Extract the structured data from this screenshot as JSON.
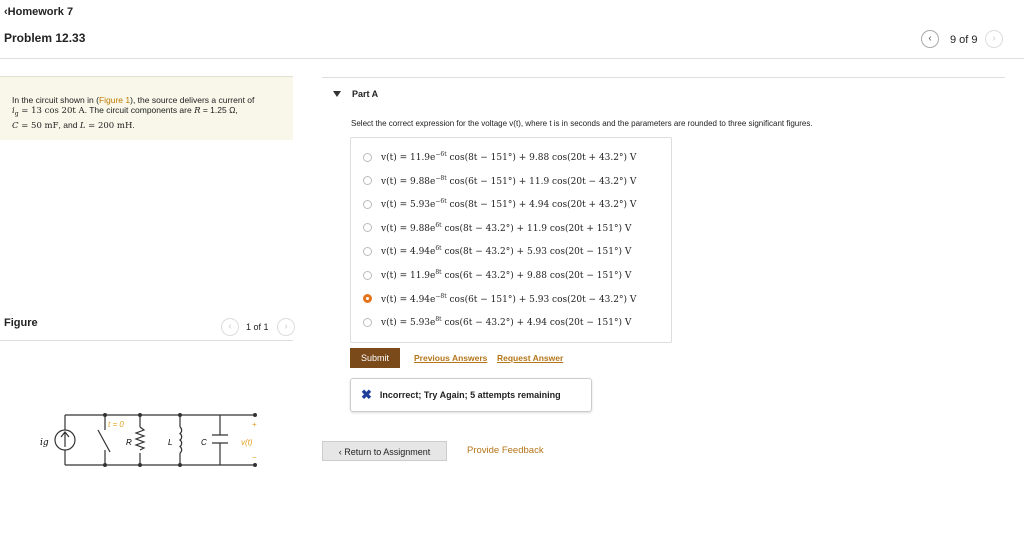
{
  "header": {
    "back": "Homework 7",
    "title": "Problem 12.33",
    "counter": "9 of 9"
  },
  "problem": {
    "text1": "In the circuit shown in (",
    "link": "Figure 1",
    "text2": "), the source delivers a current of",
    "line2a": "i",
    "line2sub": "g",
    "line2b": " = 13 cos 20t A",
    "line2c": ". The circuit components are ",
    "line2d": "R",
    "line2e": " = 1.25 Ω,",
    "line3a": "C",
    "line3b": " = 50 mF",
    "line3c": ", and ",
    "line3d": "L",
    "line3e": " = 200 mH",
    "line3f": "."
  },
  "figure": {
    "label": "Figure",
    "counter": "1 of 1",
    "labels": {
      "ig": "ig",
      "t0": "t = 0",
      "R": "R",
      "L": "L",
      "C": "C",
      "v": "v(t)",
      "plus": "+",
      "minus": "−"
    }
  },
  "partA": {
    "title": "Part A",
    "prompt": "Select the correct expression for the voltage v(t), where t is in seconds and the parameters are rounded to three significant figures.",
    "options": [
      {
        "pre": "v(t) = 11.9e",
        "exp": "−6t",
        "post": " cos(8t − 151°) + 9.88 cos(20t + 43.2°) V",
        "selected": false
      },
      {
        "pre": "v(t) = 9.88e",
        "exp": "−8t",
        "post": " cos(6t − 151°) + 11.9 cos(20t − 43.2°) V",
        "selected": false
      },
      {
        "pre": "v(t) = 5.93e",
        "exp": "−6t",
        "post": " cos(8t − 151°) + 4.94 cos(20t + 43.2°) V",
        "selected": false
      },
      {
        "pre": "v(t) = 9.88e",
        "exp": "6t",
        "post": " cos(8t − 43.2°) + 11.9 cos(20t + 151°) V",
        "selected": false
      },
      {
        "pre": "v(t) = 4.94e",
        "exp": "6t",
        "post": " cos(8t − 43.2°) + 5.93 cos(20t − 151°) V",
        "selected": false
      },
      {
        "pre": "v(t) = 11.9e",
        "exp": "8t",
        "post": " cos(6t − 43.2°) + 9.88 cos(20t − 151°) V",
        "selected": false
      },
      {
        "pre": "v(t) = 4.94e",
        "exp": "−8t",
        "post": " cos(6t − 151°) + 5.93 cos(20t − 43.2°) V",
        "selected": true
      },
      {
        "pre": "v(t) = 5.93e",
        "exp": "8t",
        "post": " cos(6t − 43.2°) + 4.94 cos(20t − 151°) V",
        "selected": false
      }
    ],
    "submit": "Submit",
    "prev": "Previous Answers",
    "request": "Request Answer",
    "feedback": "Incorrect; Try Again; 5 attempts remaining"
  },
  "footer": {
    "return": "Return to Assignment",
    "provide": "Provide Feedback"
  },
  "colors": {
    "accent": "#e5731a",
    "submit": "#7a4a1a",
    "link": "#b5761a"
  }
}
